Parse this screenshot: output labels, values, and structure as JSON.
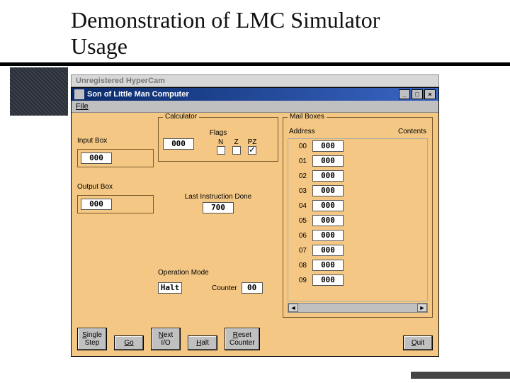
{
  "slide": {
    "title": "Demonstration of LMC Simulator Usage"
  },
  "hypercam": {
    "text": "Unregistered HyperCam"
  },
  "window": {
    "title": "Son of Little Man Computer",
    "btn_min": "_",
    "btn_max": "□",
    "btn_close": "×"
  },
  "menu": {
    "file": "File"
  },
  "labels": {
    "calculator_group": "Calculator",
    "flags_group": "Flags",
    "input_box": "Input Box",
    "output_box": "Output Box",
    "last_instr": "Last Instruction Done",
    "operation_mode": "Operation Mode",
    "counter": "Counter",
    "mailboxes": "Mail Boxes",
    "address": "Address",
    "contents": "Contents"
  },
  "flags": {
    "N": {
      "label": "N",
      "checked": false
    },
    "Z": {
      "label": "Z",
      "checked": false
    },
    "PZ": {
      "label": "PZ",
      "checked": true
    }
  },
  "values": {
    "calculator": "000",
    "input": "000",
    "output": "000",
    "last_instruction": "700",
    "operation_mode": "Halt",
    "counter": "00"
  },
  "mailboxes": [
    {
      "address": "00",
      "contents": "000"
    },
    {
      "address": "01",
      "contents": "000"
    },
    {
      "address": "02",
      "contents": "000"
    },
    {
      "address": "03",
      "contents": "000"
    },
    {
      "address": "04",
      "contents": "000"
    },
    {
      "address": "05",
      "contents": "000"
    },
    {
      "address": "06",
      "contents": "000"
    },
    {
      "address": "07",
      "contents": "000"
    },
    {
      "address": "08",
      "contents": "000"
    },
    {
      "address": "09",
      "contents": "000"
    }
  ],
  "buttons": {
    "single_step": "Single\nStep",
    "go": "Go",
    "next_io": "Next\nI/O",
    "halt": "Halt",
    "reset_counter": "Reset\nCounter",
    "quit": "Quit"
  },
  "scroll": {
    "left": "◄",
    "right": "►"
  }
}
